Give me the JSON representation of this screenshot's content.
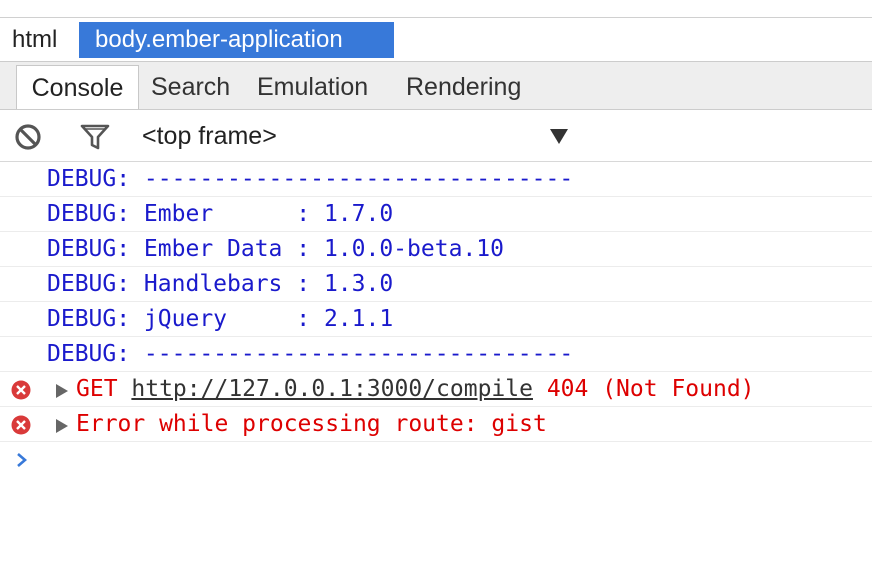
{
  "breadcrumb": {
    "items": [
      "html",
      "body.ember-application"
    ]
  },
  "tabs": {
    "items": [
      "Console",
      "Search",
      "Emulation",
      "Rendering"
    ],
    "active": "Console"
  },
  "toolbar": {
    "clear_icon": "clear-console-icon",
    "filter_icon": "filter-icon",
    "frame_value": "<top frame>",
    "dropdown_icon": "dropdown-arrow-icon"
  },
  "console": {
    "debug_lines": [
      "DEBUG: -------------------------------",
      "DEBUG: Ember      : 1.7.0",
      "DEBUG: Ember Data : 1.0.0-beta.10",
      "DEBUG: Handlebars : 1.3.0",
      "DEBUG: jQuery     : 2.1.1",
      "DEBUG: -------------------------------"
    ],
    "errors": [
      {
        "method": "GET ",
        "url": "http://127.0.0.1:3000/compile",
        "status": " 404 (Not Found)"
      },
      {
        "text": "Error while processing route: gist"
      }
    ],
    "prompt_icon": "prompt-chevron-icon"
  },
  "colors": {
    "accent": "#3879d9",
    "debug_text": "#1a1acc",
    "error_text": "#dd0000",
    "error_icon": "#d93a3a"
  }
}
